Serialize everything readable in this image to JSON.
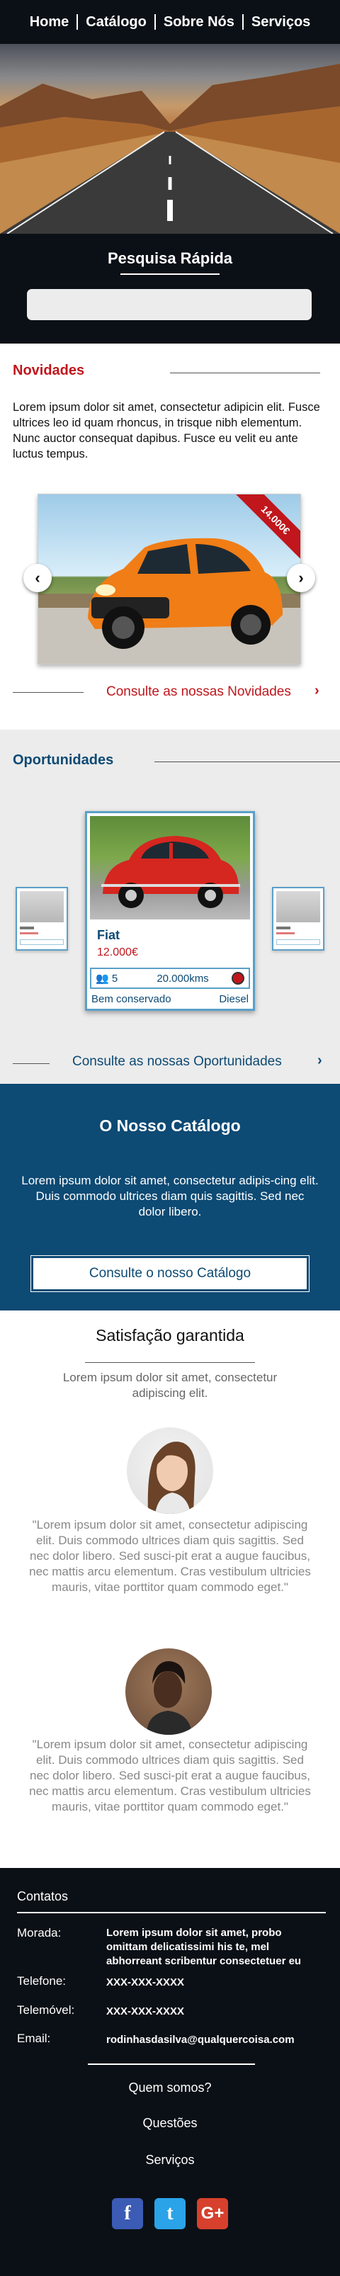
{
  "nav": {
    "items": [
      "Home",
      "Catálogo",
      "Sobre Nós",
      "Serviços"
    ]
  },
  "search": {
    "title": "Pesquisa Rápida",
    "placeholder": ""
  },
  "novidades": {
    "title": "Novidades",
    "text": "Lorem ipsum dolor sit amet, consectetur adipicin elit. Fusce ultrices leo id quam rhoncus, in trisque nibh elementum. Nunc auctor consequat dapibus. Fusce eu velit eu ante luctus tempus.",
    "ribbon": "14.000€",
    "prev_icon": "‹",
    "next_icon": "›",
    "link": "Consulte as nossas Novidades",
    "link_icon": "›"
  },
  "oportunidades": {
    "title": "Oportunidades",
    "car": {
      "name": "Fiat",
      "price": "12.000€",
      "seats": "5",
      "km": "20.000kms",
      "state": "Bem conservado",
      "fuel": "Diesel"
    },
    "link": "Consulte as nossas Oportunidades",
    "link_icon": "›"
  },
  "catalogo": {
    "title": "O Nosso Catálogo",
    "text": "Lorem ipsum dolor sit amet, consectetur adipis-cing elit. Duis commodo ultrices diam quis sagittis. Sed nec dolor libero.",
    "button": "Consulte o nosso Catálogo"
  },
  "satisfacao": {
    "title": "Satisfação garantida",
    "subtitle": "Lorem ipsum dolor sit amet, consectetur adipiscing elit.",
    "testimonials": [
      {
        "quote": "\"Lorem ipsum dolor sit amet, consectetur adipiscing elit. Duis commodo ultrices diam quis sagittis. Sed nec dolor libero. Sed susci-pit erat a augue faucibus, nec mattis arcu elementum. Cras vestibulum ultricies mauris, vitae porttitor quam commodo eget.\""
      },
      {
        "quote": "\"Lorem ipsum dolor sit amet, consectetur adipiscing elit. Duis commodo ultrices diam quis sagittis. Sed nec dolor libero. Sed susci-pit erat a augue faucibus, nec mattis arcu elementum. Cras vestibulum ultricies mauris, vitae porttitor quam commodo eget.\""
      }
    ]
  },
  "footer": {
    "heading": "Contatos",
    "morada_label": "Morada:",
    "morada_value": "Lorem ipsum dolor sit amet, probo omittam delicatissimi his te, mel abhorreant scribentur consectetuer eu",
    "telefone_label": "Telefone:",
    "telefone_value": "XXX-XXX-XXXX",
    "telemovel_label": "Telemóvel:",
    "telemovel_value": "XXX-XXX-XXXX",
    "email_label": "Email:",
    "email_value": "rodinhasdasilva@qualquercoisa.com",
    "links": [
      "Quem somos?",
      "Questões",
      "Serviços"
    ],
    "social": [
      "f",
      "t",
      "G+"
    ]
  }
}
